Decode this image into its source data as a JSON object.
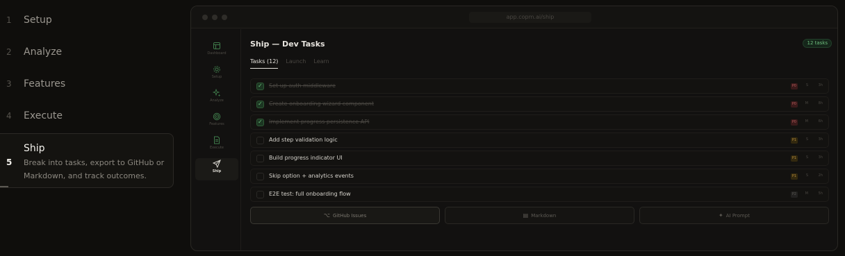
{
  "steps": [
    {
      "num": "1",
      "label": "Setup"
    },
    {
      "num": "2",
      "label": "Analyze"
    },
    {
      "num": "3",
      "label": "Features"
    },
    {
      "num": "4",
      "label": "Execute"
    }
  ],
  "active_step": {
    "num": "5",
    "label": "Ship",
    "description": "Break into tasks, export to GitHub or Markdown, and track outcomes."
  },
  "window": {
    "url": "app.copm.ai/ship"
  },
  "nav": [
    {
      "label": "Dashboard",
      "icon": "dashboard-icon"
    },
    {
      "label": "Setup",
      "icon": "settings-icon"
    },
    {
      "label": "Analyze",
      "icon": "sparkle-icon"
    },
    {
      "label": "Features",
      "icon": "target-icon"
    },
    {
      "label": "Execute",
      "icon": "document-icon"
    },
    {
      "label": "Ship",
      "icon": "send-icon"
    }
  ],
  "page": {
    "title": "Ship — Dev Tasks",
    "badge": "12 tasks"
  },
  "tabs": [
    {
      "label": "Tasks (12)"
    },
    {
      "label": "Launch"
    },
    {
      "label": "Learn"
    }
  ],
  "tasks": [
    {
      "title": "Set up auth middleware",
      "done": true,
      "priority": "P0",
      "size": "S",
      "hours": "3h"
    },
    {
      "title": "Create onboarding wizard component",
      "done": true,
      "priority": "P0",
      "size": "M",
      "hours": "8h"
    },
    {
      "title": "Implement progress persistence API",
      "done": true,
      "priority": "P0",
      "size": "M",
      "hours": "6h"
    },
    {
      "title": "Add step validation logic",
      "done": false,
      "priority": "P1",
      "size": "S",
      "hours": "3h"
    },
    {
      "title": "Build progress indicator UI",
      "done": false,
      "priority": "P1",
      "size": "S",
      "hours": "3h"
    },
    {
      "title": "Skip option + analytics events",
      "done": false,
      "priority": "P1",
      "size": "S",
      "hours": "2h"
    },
    {
      "title": "E2E test: full onboarding flow",
      "done": false,
      "priority": "P2",
      "size": "M",
      "hours": "5h"
    }
  ],
  "exports": [
    {
      "label": "GitHub Issues",
      "icon": "github-icon"
    },
    {
      "label": "Markdown",
      "icon": "file-icon"
    },
    {
      "label": "AI Prompt",
      "icon": "sparkle-icon"
    }
  ],
  "colors": {
    "accent_green": "#6fbf7e",
    "p0": "#b35a5a",
    "p1": "#b38a3a",
    "background": "#0f0e0c"
  }
}
